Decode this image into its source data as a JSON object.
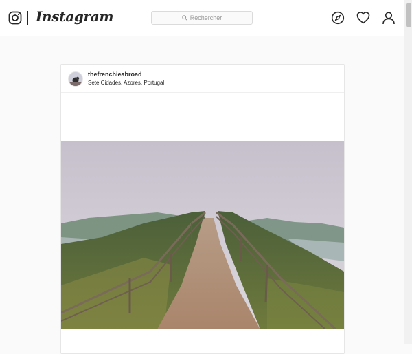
{
  "header": {
    "logo_text": "Instagram",
    "search_placeholder": "Rechercher",
    "icons": [
      "instagram-camera-icon",
      "search-icon",
      "compass-icon",
      "heart-icon",
      "profile-icon"
    ]
  },
  "post": {
    "username": "thefrenchieabroad",
    "location": "Sete Cidades, Azores, Portugal",
    "image_subject": "dirt path between wooden railings on a ridge, lake and hills, overcast sky"
  },
  "colors": {
    "text": "#262626",
    "border": "#dbdbdb",
    "background": "#fafafa"
  }
}
